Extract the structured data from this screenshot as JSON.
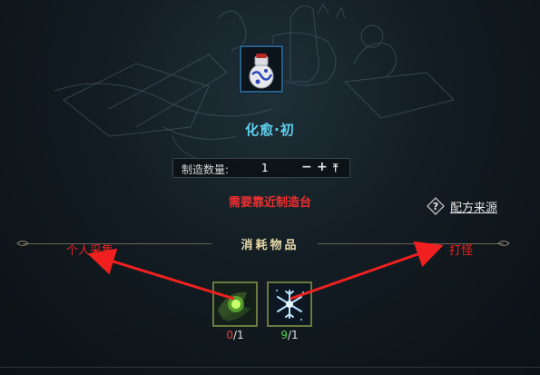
{
  "item": {
    "name": "化愈·初",
    "icon": "medicine-jar-icon"
  },
  "craft": {
    "quantity_label": "制造数量:",
    "quantity_value": "1",
    "minus_symbol": "−",
    "plus_symbol": "+",
    "max_symbol": "⤒"
  },
  "warning": "需要靠近制造台",
  "recipe_source": {
    "label": "配方来源",
    "icon": "question-diamond-icon"
  },
  "materials": {
    "title": "消耗物品",
    "items": [
      {
        "icon": "green-orb-leaf-icon",
        "have": "0",
        "sep_need": "/1",
        "have_color": "#f03a3a"
      },
      {
        "icon": "snowflake-crystal-icon",
        "have": "9",
        "sep_need": "/1",
        "have_color": "#4fd04f"
      }
    ]
  },
  "annotations": {
    "left": "个人采集",
    "right": "打怪",
    "arrow_color": "#f02020"
  }
}
